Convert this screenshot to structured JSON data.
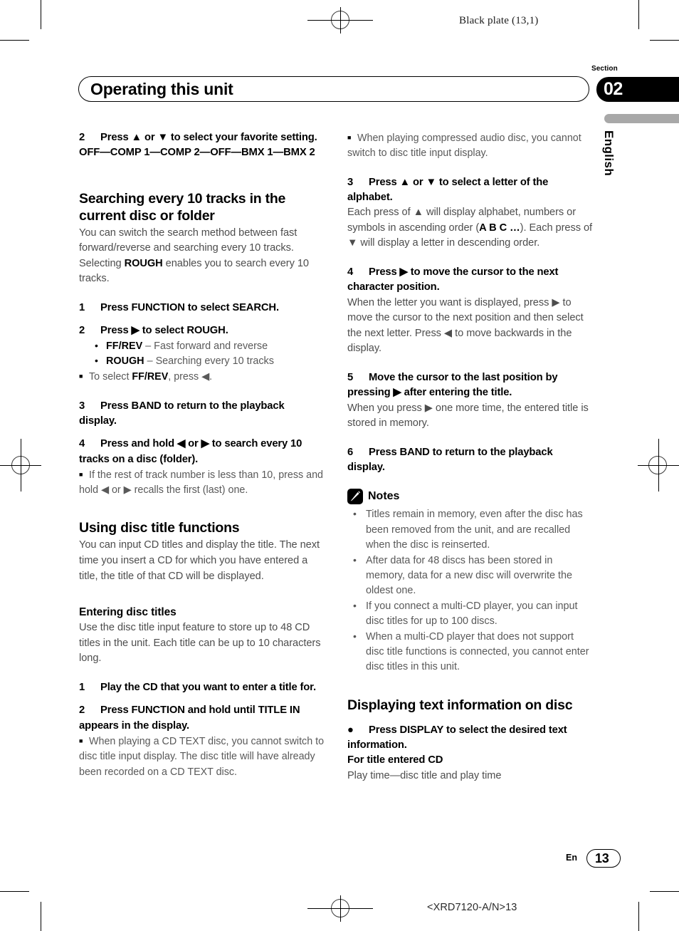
{
  "page": {
    "plate_label": "Black plate (13,1)",
    "running_head": "Operating this unit",
    "section_word": "Section",
    "section_number": "02",
    "language_tab": "English",
    "footer_lang": "En",
    "footer_page": "13",
    "footer_code": "<XRD7120-A/N>13",
    "accent_black": "#000000",
    "tab_gray": "#a8a8a8",
    "body_gray": "#4d4d4d"
  },
  "left_column": {
    "step2_label": "2",
    "step2_text": "Press ▲ or ▼ to select your favorite setting.",
    "step2_values": "OFF—COMP 1—COMP 2—OFF—BMX 1—BMX 2",
    "heading_search": "Searching every 10 tracks in the current disc or folder",
    "search_intro_a": "You can switch the search method between fast forward/reverse and searching every 10 tracks. Selecting ",
    "search_intro_b": "ROUGH",
    "search_intro_c": " enables you to search every 10 tracks.",
    "s1_num": "1",
    "s1_text": "Press FUNCTION to select SEARCH.",
    "s2_num": "2",
    "s2_text": "Press ▶ to select ROUGH.",
    "bullet1_bold": "FF/REV",
    "bullet1_rest": " – Fast forward and reverse",
    "bullet2_bold": "ROUGH",
    "bullet2_rest": " – Searching every 10 tracks",
    "note1_a": "To select ",
    "note1_b": "FF/REV",
    "note1_c": ", press ◀.",
    "s3_num": "3",
    "s3_text": "Press BAND to return to the playback display.",
    "s4_num": "4",
    "s4_text": "Press and hold ◀ or ▶ to search every 10 tracks on a disc (folder).",
    "note2": "If the rest of track number is less than 10, press and hold ◀ or ▶ recalls the first (last) one.",
    "heading_disc_title": "Using disc title functions",
    "disc_title_intro": "You can input CD titles and display the title. The next time you insert a CD for which you have entered a title, the title of that CD will be displayed.",
    "subhead_entering": "Entering disc titles",
    "entering_intro": "Use the disc title input feature to store up to 48 CD titles in the unit. Each title can be up to 10 characters long.",
    "e1_num": "1",
    "e1_text": "Play the CD that you want to enter a title for.",
    "e2_num": "2",
    "e2_text": "Press FUNCTION and hold until TITLE IN appears in the display.",
    "note3": "When playing a CD TEXT disc, you cannot switch to disc title input display. The disc title will have already been recorded on a CD TEXT disc."
  },
  "right_column": {
    "note4": "When playing compressed audio disc, you cannot switch to disc title input display.",
    "e3_num": "3",
    "e3_text": "Press ▲ or ▼ to select a letter of the alphabet.",
    "e3_body_a": "Each press of ▲ will display alphabet, numbers or symbols in ascending order (",
    "e3_body_b": "A B C …",
    "e3_body_c": "). Each press of ▼ will display a letter in descending order.",
    "e4_num": "4",
    "e4_text": "Press ▶ to move the cursor to the next character position.",
    "e4_body": "When the letter you want is displayed, press ▶ to move the cursor to the next position and then select the next letter. Press ◀ to move backwards in the display.",
    "e5_num": "5",
    "e5_text": "Move the cursor to the last position by pressing ▶ after entering the title.",
    "e5_body": "When you press ▶ one more time, the entered title is stored in memory.",
    "e6_num": "6",
    "e6_text": "Press BAND to return to the playback display.",
    "notes_label": "Notes",
    "notes": [
      "Titles remain in memory, even after the disc has been removed from the unit, and are recalled when the disc is reinserted.",
      "After data for 48 discs has been stored in memory, data for a new disc will overwrite the oldest one.",
      "If you connect a multi-CD player, you can input disc titles for up to 100 discs.",
      "When a multi-CD player that does not support disc title functions is connected, you cannot enter disc titles in this unit."
    ],
    "heading_display_text": "Displaying text information on disc",
    "d1_bullet": "●",
    "d1_text": "Press DISPLAY to select the desired text information.",
    "d1_sub": "For title entered CD",
    "d1_body": "Play time—disc title and play time"
  }
}
